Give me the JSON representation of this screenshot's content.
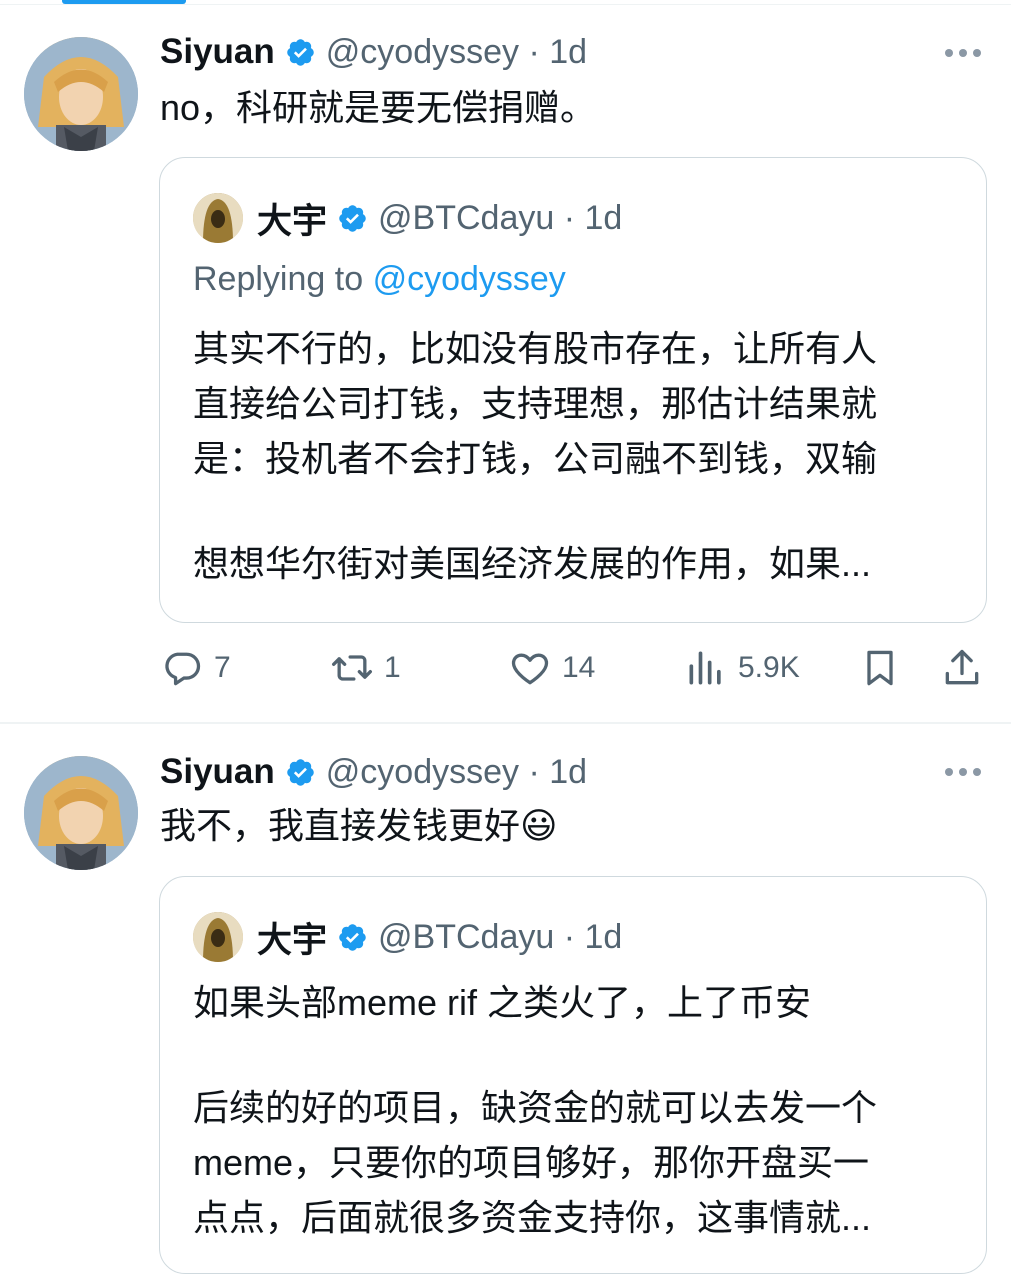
{
  "tweets": [
    {
      "author": "Siyuan",
      "handle": "@cyodyssey",
      "time": "1d",
      "text": "no，科研就是要无偿捐赠。",
      "quote": {
        "author": "大宇",
        "handle": "@BTCdayu",
        "time": "1d",
        "replying_to_label": "Replying to",
        "replying_to_handle": "@cyodyssey",
        "lines": [
          "其实不行的，比如没有股市存在，让所有人",
          "直接给公司打钱，支持理想，那估计结果就",
          "是：投机者不会打钱，公司融不到钱，双输",
          "",
          "想想华尔街对美国经济发展的作用，如果..."
        ]
      },
      "actions": {
        "replies": "7",
        "retweets": "1",
        "likes": "14",
        "views": "5.9K"
      }
    },
    {
      "author": "Siyuan",
      "handle": "@cyodyssey",
      "time": "1d",
      "text": "我不，我直接发钱更好",
      "emoji": "😃",
      "quote": {
        "author": "大宇",
        "handle": "@BTCdayu",
        "time": "1d",
        "lines": [
          "如果头部meme rif 之类火了，上了币安",
          "",
          "后续的好的项目，缺资金的就可以去发一个",
          "meme，只要你的项目够好，那你开盘买一",
          "点点，后面就很多资金支持你，这事情就..."
        ]
      }
    }
  ],
  "icons": {
    "verified": "verified-badge-icon",
    "more": "more-horizontal-icon",
    "reply": "reply-icon",
    "retweet": "retweet-icon",
    "like": "heart-icon",
    "views": "views-chart-icon",
    "bookmark": "bookmark-icon",
    "share": "share-icon"
  },
  "colors": {
    "accent": "#1d9bf0",
    "text": "#0f1419",
    "muted": "#536471",
    "border": "#cfd9de"
  }
}
